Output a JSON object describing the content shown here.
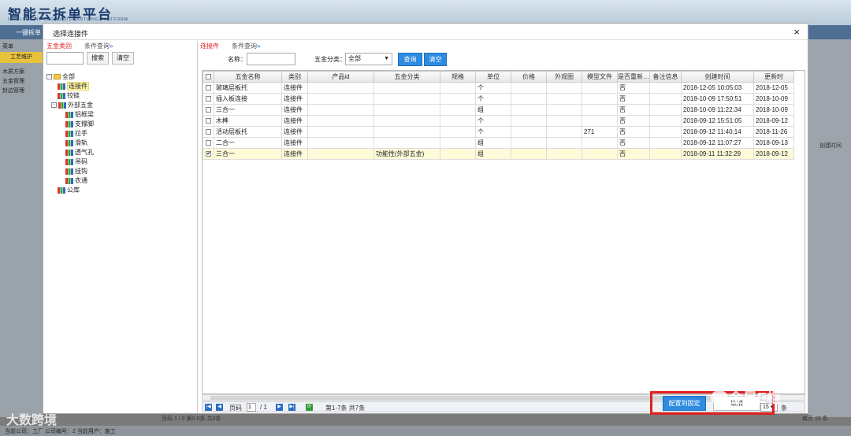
{
  "app": {
    "logo": "智能云拆单平台",
    "logo_sub": "INTELLIGENT CLOUD DISMANTLING PLATFORM",
    "bar_label": "一键拆单",
    "menu_label": "菜单",
    "menu_button": "工艺维护",
    "menu_items": [
      "木质方案",
      "五金管理",
      "封边管理"
    ],
    "right_col": "创建时间",
    "status": "当前公司：工厂  公司编号：2  当前用户：施工",
    "bg_pager": "页码 1 / 0    第0-0条 共0条",
    "bg_pager_right": "每页 15 条"
  },
  "watermark": {
    "left": "大数跨境",
    "right": "金星E柜"
  },
  "dialog": {
    "title": "选择连接件",
    "close": "×",
    "left": {
      "tab1": "五金类别",
      "tab2": "条件查询",
      "search_btn": "搜索",
      "clear_btn": "清空",
      "tree": {
        "root": "全部",
        "n1": "连接件",
        "n2": "铰链",
        "n3": "外部五金",
        "c1": "铝框梁",
        "c2": "支撑脚",
        "c3": "拉手",
        "c4": "滑轨",
        "c5": "透气孔",
        "c6": "吊码",
        "c7": "挂钩",
        "c8": "衣通",
        "n4": "公库"
      }
    },
    "right": {
      "tab1": "连接件",
      "tab2": "条件查询",
      "name_label": "名称：",
      "name_value": "",
      "cat_label": "五金分类：",
      "cat_value": "全部",
      "query_btn": "查询",
      "clear_btn": "清空"
    },
    "grid": {
      "headers": [
        "五金名称",
        "类别",
        "产品id",
        "五金分类",
        "规格",
        "单位",
        "价格",
        "外观图",
        "模型文件",
        "是否重新…",
        "备注信息",
        "创建时间",
        "更新时"
      ],
      "rows": [
        {
          "c": [
            "玻璃层板托",
            "连接件",
            "",
            "",
            "",
            "个",
            "",
            "",
            "",
            "否",
            "",
            "2018-12-05 10:05:03",
            "2018-12-05"
          ],
          "checked": ""
        },
        {
          "c": [
            "插入板连接",
            "连接件",
            "",
            "",
            "",
            "个",
            "",
            "",
            "",
            "否",
            "",
            "2018-10-09 17:50:51",
            "2018-10-09"
          ],
          "checked": ""
        },
        {
          "c": [
            "三合一",
            "连接件",
            "",
            "",
            "",
            "组",
            "",
            "",
            "",
            "否",
            "",
            "2018-10-09 11:22:34",
            "2018-10-09"
          ],
          "checked": ""
        },
        {
          "c": [
            "木榫",
            "连接件",
            "",
            "",
            "",
            "个",
            "",
            "",
            "",
            "否",
            "",
            "2018-09-12 15:51:05",
            "2018-09-12"
          ],
          "checked": ""
        },
        {
          "c": [
            "活动层板托",
            "连接件",
            "",
            "",
            "",
            "个",
            "",
            "",
            "271",
            "否",
            "",
            "2018-09-12 11:40:14",
            "2018-11-26"
          ],
          "checked": ""
        },
        {
          "c": [
            "二合一",
            "连接件",
            "",
            "",
            "",
            "组",
            "",
            "",
            "",
            "否",
            "",
            "2018-09-12 11:07:27",
            "2018-09-13"
          ],
          "checked": ""
        },
        {
          "c": [
            "三合一",
            "连接件",
            "",
            "功能性(外部五金)",
            "",
            "组",
            "",
            "",
            "",
            "否",
            "",
            "2018-09-11 11:32:29",
            "2018-09-12"
          ],
          "checked": "✔"
        }
      ]
    },
    "pager": {
      "page_label": "页码",
      "page": "1",
      "total": "/ 1",
      "range": "第1-7条  共7条",
      "per_label": "每页",
      "per": "15",
      "per_unit": "条"
    },
    "ok_btn": "配置到固定",
    "cancel_btn": "取消"
  }
}
